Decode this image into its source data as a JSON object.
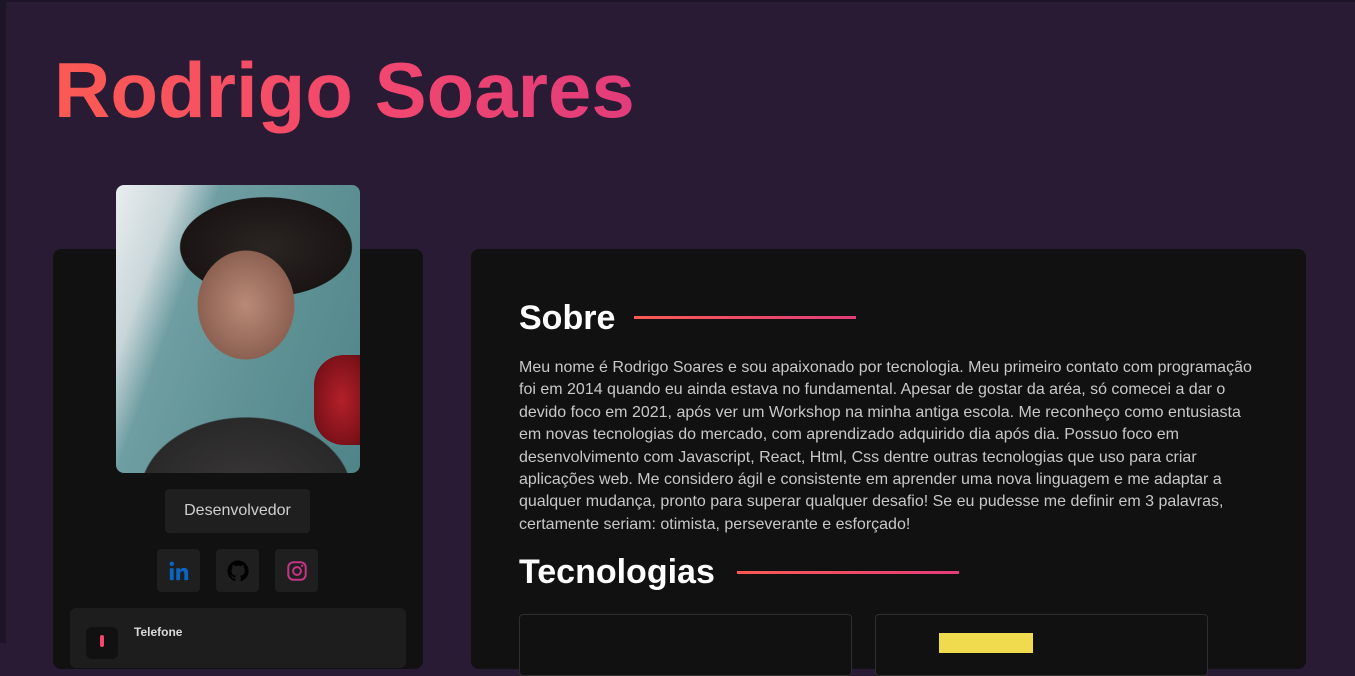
{
  "profile": {
    "name": "Rodrigo Soares",
    "role": "Desenvolvedor",
    "social": [
      {
        "icon": "linkedin-icon",
        "color": "#0a66c2"
      },
      {
        "icon": "github-icon",
        "color": "#000000"
      },
      {
        "icon": "instagram-icon",
        "color": "#c13584"
      }
    ],
    "contact": {
      "label": "Telefone"
    }
  },
  "about": {
    "title": "Sobre",
    "text": "Meu nome é Rodrigo Soares e sou apaixonado por tecnologia. Meu primeiro contato com programação foi em 2014 quando eu ainda estava no fundamental. Apesar de gostar da aréa, só comecei a dar o devido foco em 2021, após ver um Workshop na minha antiga escola. Me reconheço como entusiasta em novas tecnologias do mercado, com aprendizado adquirido dia após dia. Possuo foco em desenvolvimento com Javascript, React, Html, Css dentre outras tecnologias que uso para criar aplicações web. Me considero ágil e consistente em aprender uma nova linguagem e me adaptar a qualquer mudança, pronto para superar qualquer desafio! Se eu pudesse me definir em 3 palavras, certamente seriam: otimista, perseverante e esforçado!"
  },
  "technologies": {
    "title": "Tecnologias"
  },
  "colors": {
    "background": "#2a1b34",
    "card": "#111111",
    "accent_start": "#fb5a53",
    "accent_end": "#e23c7a"
  }
}
